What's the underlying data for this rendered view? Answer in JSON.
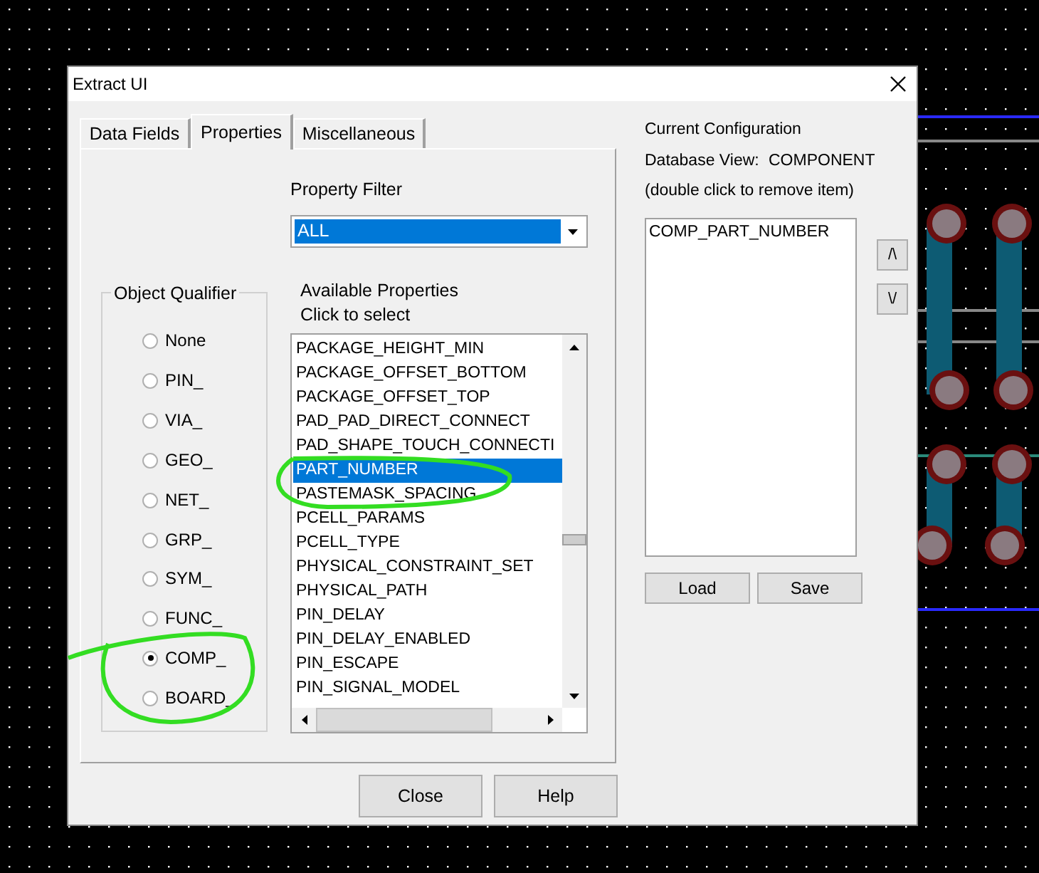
{
  "window": {
    "title": "Extract UI"
  },
  "tabs": [
    {
      "label": "Data Fields",
      "selected": false
    },
    {
      "label": "Properties",
      "selected": true
    },
    {
      "label": "Miscellaneous",
      "selected": false
    }
  ],
  "property_filter": {
    "label": "Property Filter",
    "value": "ALL"
  },
  "available_properties": {
    "label": "Available Properties",
    "hint": "Click to select",
    "items": [
      {
        "label": "PACKAGE_HEIGHT_MIN",
        "selected": false
      },
      {
        "label": "PACKAGE_OFFSET_BOTTOM",
        "selected": false
      },
      {
        "label": "PACKAGE_OFFSET_TOP",
        "selected": false
      },
      {
        "label": "PAD_PAD_DIRECT_CONNECT",
        "selected": false
      },
      {
        "label": "PAD_SHAPE_TOUCH_CONNECTI",
        "selected": false
      },
      {
        "label": "PART_NUMBER",
        "selected": true
      },
      {
        "label": "PASTEMASK_SPACING",
        "selected": false
      },
      {
        "label": "PCELL_PARAMS",
        "selected": false
      },
      {
        "label": "PCELL_TYPE",
        "selected": false
      },
      {
        "label": "PHYSICAL_CONSTRAINT_SET",
        "selected": false
      },
      {
        "label": "PHYSICAL_PATH",
        "selected": false
      },
      {
        "label": "PIN_DELAY",
        "selected": false
      },
      {
        "label": "PIN_DELAY_ENABLED",
        "selected": false
      },
      {
        "label": "PIN_ESCAPE",
        "selected": false
      },
      {
        "label": "PIN_SIGNAL_MODEL",
        "selected": false
      }
    ]
  },
  "object_qualifier": {
    "title": "Object Qualifier",
    "options": [
      {
        "label": "None",
        "selected": false
      },
      {
        "label": "PIN_",
        "selected": false
      },
      {
        "label": "VIA_",
        "selected": false
      },
      {
        "label": "GEO_",
        "selected": false
      },
      {
        "label": "NET_",
        "selected": false
      },
      {
        "label": "GRP_",
        "selected": false
      },
      {
        "label": "SYM_",
        "selected": false
      },
      {
        "label": "FUNC_",
        "selected": false
      },
      {
        "label": "COMP_",
        "selected": true
      },
      {
        "label": "BOARD_",
        "selected": false
      }
    ]
  },
  "current_configuration": {
    "title": "Current Configuration",
    "database_view_label": "Database View:",
    "database_view": "COMPONENT",
    "hint": "(double click to remove item)",
    "items": [
      "COMP_PART_NUMBER"
    ],
    "move_up": "/\\",
    "move_down": "\\/",
    "buttons": [
      "Load",
      "Save"
    ]
  },
  "buttons": [
    "Close",
    "Help"
  ]
}
